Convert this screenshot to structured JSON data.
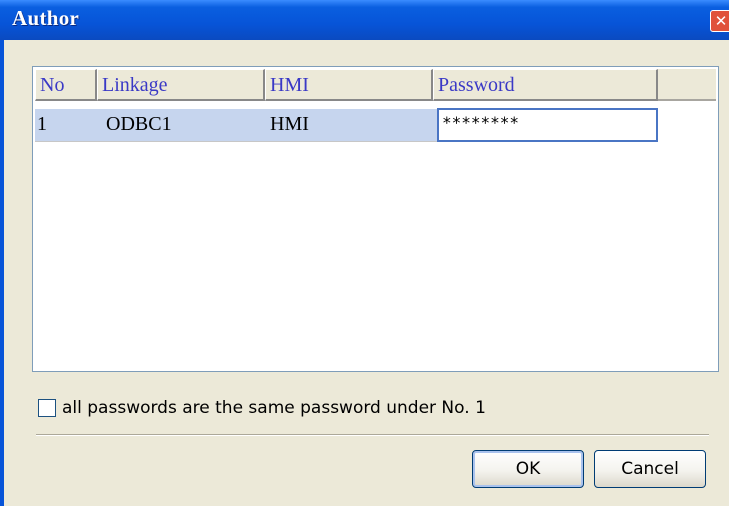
{
  "window": {
    "title": "Author",
    "close_glyph": "✕"
  },
  "grid": {
    "columns": [
      "No",
      "Linkage",
      "HMI",
      "Password"
    ],
    "rows": [
      {
        "no": "1",
        "linkage": "ODBC1",
        "hmi": "HMI",
        "password": "********"
      }
    ]
  },
  "options": {
    "same_password_label": "all passwords are the same password under No. 1",
    "same_password_checked": false
  },
  "buttons": {
    "ok": "OK",
    "cancel": "Cancel"
  },
  "colors": {
    "title_bar": "#0754d8",
    "header_text": "#3a39c6",
    "row_highlight": "#c6d5ee",
    "face": "#ece9d8"
  }
}
